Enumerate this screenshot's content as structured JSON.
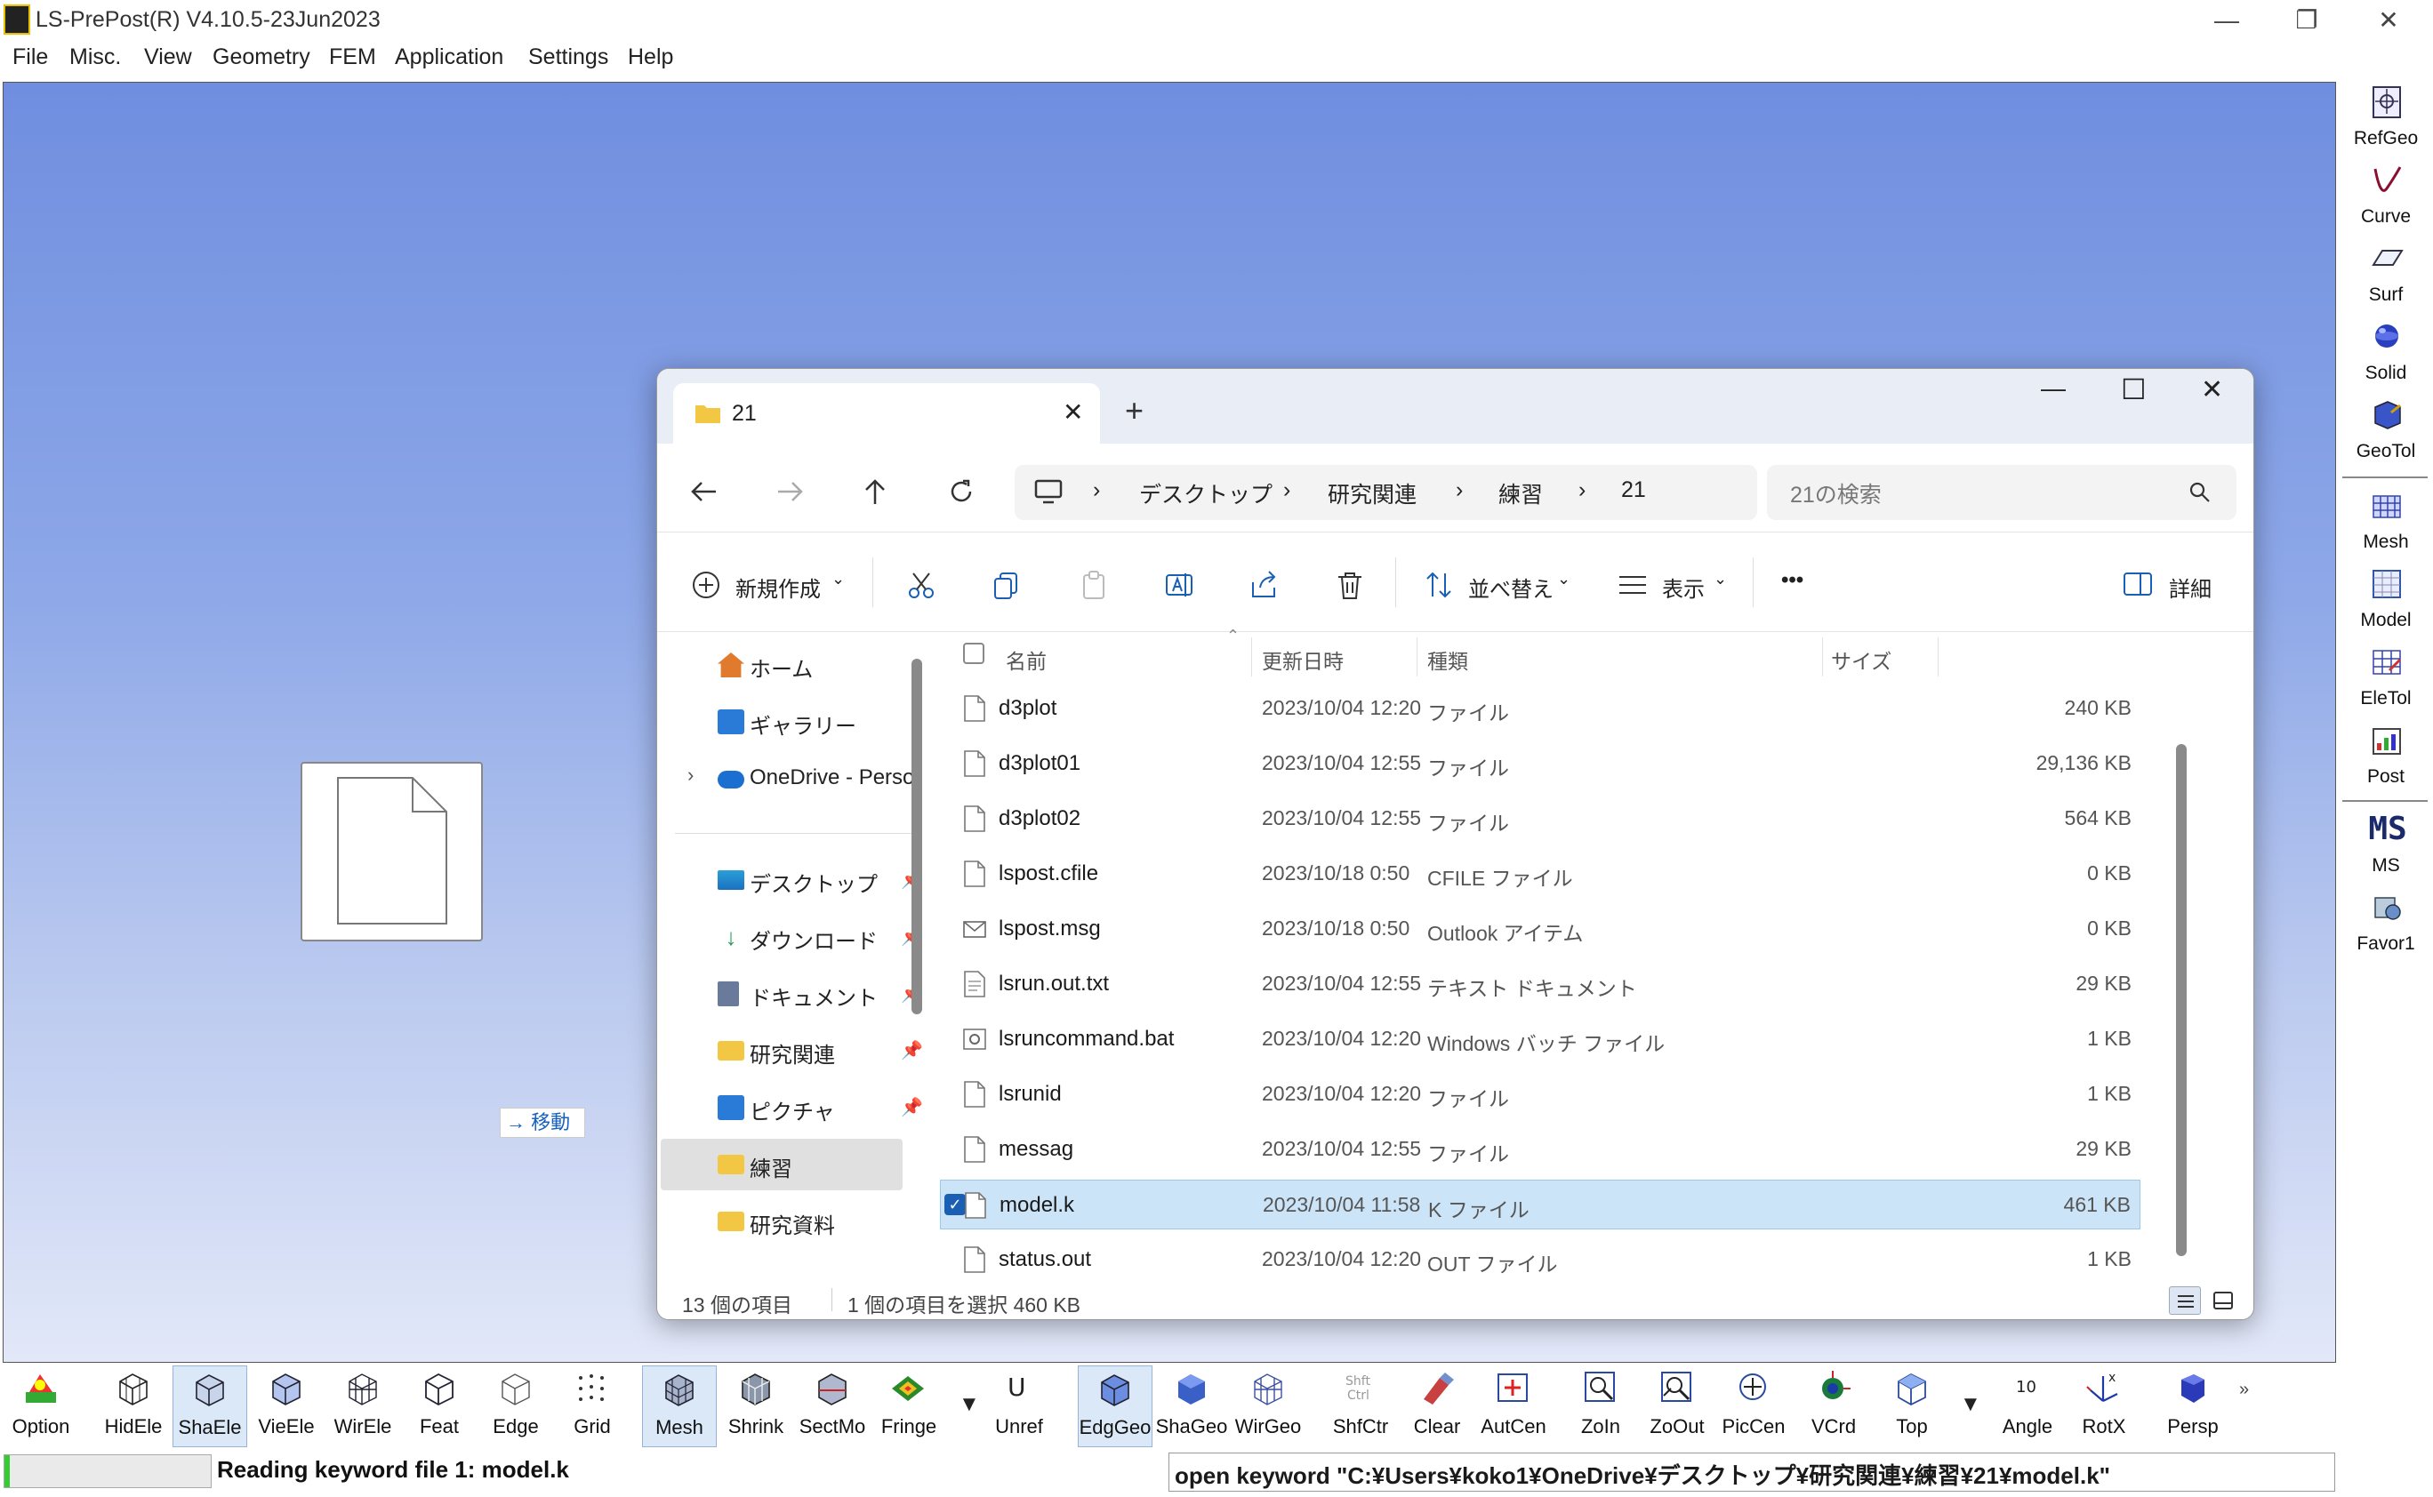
{
  "app": {
    "title": "LS-PrePost(R) V4.10.5-23Jun2023",
    "window_controls": {
      "minimize": "—",
      "maximize": "❐",
      "close": "✕"
    }
  },
  "menubar": [
    "File",
    "Misc.",
    "View",
    "Geometry",
    "FEM",
    "Application",
    "Settings",
    "Help"
  ],
  "right_toolbar": [
    {
      "label": "RefGeo",
      "icon": "refgeo-icon"
    },
    {
      "label": "Curve",
      "icon": "curve-icon"
    },
    {
      "label": "Surf",
      "icon": "surf-icon"
    },
    {
      "label": "Solid",
      "icon": "solid-icon"
    },
    {
      "label": "GeoTol",
      "icon": "geotol-icon"
    },
    {
      "label": "Mesh",
      "icon": "mesh-icon"
    },
    {
      "label": "Model",
      "icon": "model-icon"
    },
    {
      "label": "EleTol",
      "icon": "eletol-icon"
    },
    {
      "label": "Post",
      "icon": "post-icon"
    },
    {
      "label": "MS",
      "icon": "ms-icon"
    },
    {
      "label": "Favor1",
      "icon": "favor-icon"
    }
  ],
  "drag": {
    "hint": "→ 移動"
  },
  "explorer": {
    "tab_title": "21",
    "tab_close": "✕",
    "new_tab": "+",
    "window_controls": {
      "minimize": "—",
      "maximize": "☐",
      "close": "✕"
    },
    "breadcrumbs": [
      "デスクトップ",
      "研究関連",
      "練習",
      "21"
    ],
    "search_placeholder": "21の検索",
    "commands": {
      "new": "新規作成",
      "sort": "並べ替え",
      "view": "表示",
      "more": "•••",
      "details": "詳細"
    },
    "nav": [
      {
        "label": "ホーム",
        "pinned": false,
        "color": "#e07a2c"
      },
      {
        "label": "ギャラリー",
        "pinned": false,
        "color": "#2a7ad8"
      },
      {
        "label": "OneDrive - Perso",
        "pinned": false,
        "color": "#1a6fd0",
        "expandable": true
      },
      {
        "label": "デスクトップ",
        "pinned": true,
        "color": "#2aa0d8"
      },
      {
        "label": "ダウンロード",
        "pinned": true,
        "color": "#2a9a5a"
      },
      {
        "label": "ドキュメント",
        "pinned": true,
        "color": "#6a7a9a"
      },
      {
        "label": "研究関連",
        "pinned": true,
        "color": "#f2c744"
      },
      {
        "label": "ピクチャ",
        "pinned": true,
        "color": "#2a7ad8"
      },
      {
        "label": "練習",
        "pinned": false,
        "color": "#f2c744",
        "selected": true
      },
      {
        "label": "研究資料",
        "pinned": false,
        "color": "#f2c744"
      }
    ],
    "pin_glyph": "📌",
    "columns": {
      "name": "名前",
      "date": "更新日時",
      "type": "種類",
      "size": "サイズ"
    },
    "files": [
      {
        "name": "d3plot",
        "date": "2023/10/04 12:20",
        "type": "ファイル",
        "size": "240 KB",
        "icon": "file-icon"
      },
      {
        "name": "d3plot01",
        "date": "2023/10/04 12:55",
        "type": "ファイル",
        "size": "29,136 KB",
        "icon": "file-icon"
      },
      {
        "name": "d3plot02",
        "date": "2023/10/04 12:55",
        "type": "ファイル",
        "size": "564 KB",
        "icon": "file-icon"
      },
      {
        "name": "lspost.cfile",
        "date": "2023/10/18 0:50",
        "type": "CFILE ファイル",
        "size": "0 KB",
        "icon": "file-icon"
      },
      {
        "name": "lspost.msg",
        "date": "2023/10/18 0:50",
        "type": "Outlook アイテム",
        "size": "0 KB",
        "icon": "mail-icon"
      },
      {
        "name": "lsrun.out.txt",
        "date": "2023/10/04 12:55",
        "type": "テキスト ドキュメント",
        "size": "29 KB",
        "icon": "text-file-icon"
      },
      {
        "name": "lsruncommand.bat",
        "date": "2023/10/04 12:20",
        "type": "Windows バッチ ファイル",
        "size": "1 KB",
        "icon": "batch-file-icon"
      },
      {
        "name": "lsrunid",
        "date": "2023/10/04 12:20",
        "type": "ファイル",
        "size": "1 KB",
        "icon": "file-icon"
      },
      {
        "name": "messag",
        "date": "2023/10/04 12:55",
        "type": "ファイル",
        "size": "29 KB",
        "icon": "file-icon"
      },
      {
        "name": "model.k",
        "date": "2023/10/04 11:58",
        "type": "K ファイル",
        "size": "461 KB",
        "icon": "file-icon",
        "selected": true
      },
      {
        "name": "status.out",
        "date": "2023/10/04 12:20",
        "type": "OUT ファイル",
        "size": "1 KB",
        "icon": "file-icon"
      }
    ],
    "status": {
      "count": "13 個の項目",
      "selection": "1 個の項目を選択  460 KB"
    }
  },
  "bottom_toolbar": [
    {
      "label": "Option",
      "icon": "option-icon"
    },
    {
      "label": "HidEle",
      "icon": "hidele-icon"
    },
    {
      "label": "ShaEle",
      "icon": "shaele-icon",
      "active": true
    },
    {
      "label": "VieEle",
      "icon": "vieele-icon"
    },
    {
      "label": "WirEle",
      "icon": "wirele-icon"
    },
    {
      "label": "Feat",
      "icon": "feat-icon"
    },
    {
      "label": "Edge",
      "icon": "edge-icon"
    },
    {
      "label": "Grid",
      "icon": "grid-icon"
    },
    {
      "label": "Mesh",
      "icon": "mesh-icon",
      "active": true
    },
    {
      "label": "Shrink",
      "icon": "shrink-icon"
    },
    {
      "label": "SectMo",
      "icon": "sectmo-icon"
    },
    {
      "label": "Fringe",
      "icon": "fringe-icon"
    },
    {
      "label": "Unref",
      "icon": "unref-icon"
    },
    {
      "label": "EdgGeo",
      "icon": "edggeo-icon",
      "active": true
    },
    {
      "label": "ShaGeo",
      "icon": "shageo-icon"
    },
    {
      "label": "WirGeo",
      "icon": "wirgeo-icon"
    },
    {
      "label": "ShfCtr",
      "icon": "shfctr-icon"
    },
    {
      "label": "Clear",
      "icon": "clear-icon"
    },
    {
      "label": "AutCen",
      "icon": "autcen-icon"
    },
    {
      "label": "ZoIn",
      "icon": "zoom-in-icon"
    },
    {
      "label": "ZoOut",
      "icon": "zoom-out-icon"
    },
    {
      "label": "PicCen",
      "icon": "piccen-icon"
    },
    {
      "label": "VCrd",
      "icon": "vcrd-icon"
    },
    {
      "label": "Top",
      "icon": "top-view-icon"
    },
    {
      "label": "Angle",
      "icon": "angle-icon"
    },
    {
      "label": "RotX",
      "icon": "rotx-icon"
    },
    {
      "label": "Persp",
      "icon": "persp-icon"
    }
  ],
  "icon_text": {
    "unref": "U",
    "shfctr": "Shft\nCtrl",
    "angle": "10",
    "ms": "MS"
  },
  "status_message": "Reading keyword file 1: model.k",
  "command_line": "open keyword \"C:¥Users¥koko1¥OneDrive¥デスクトップ¥研究関連¥練習¥21¥model.k\""
}
